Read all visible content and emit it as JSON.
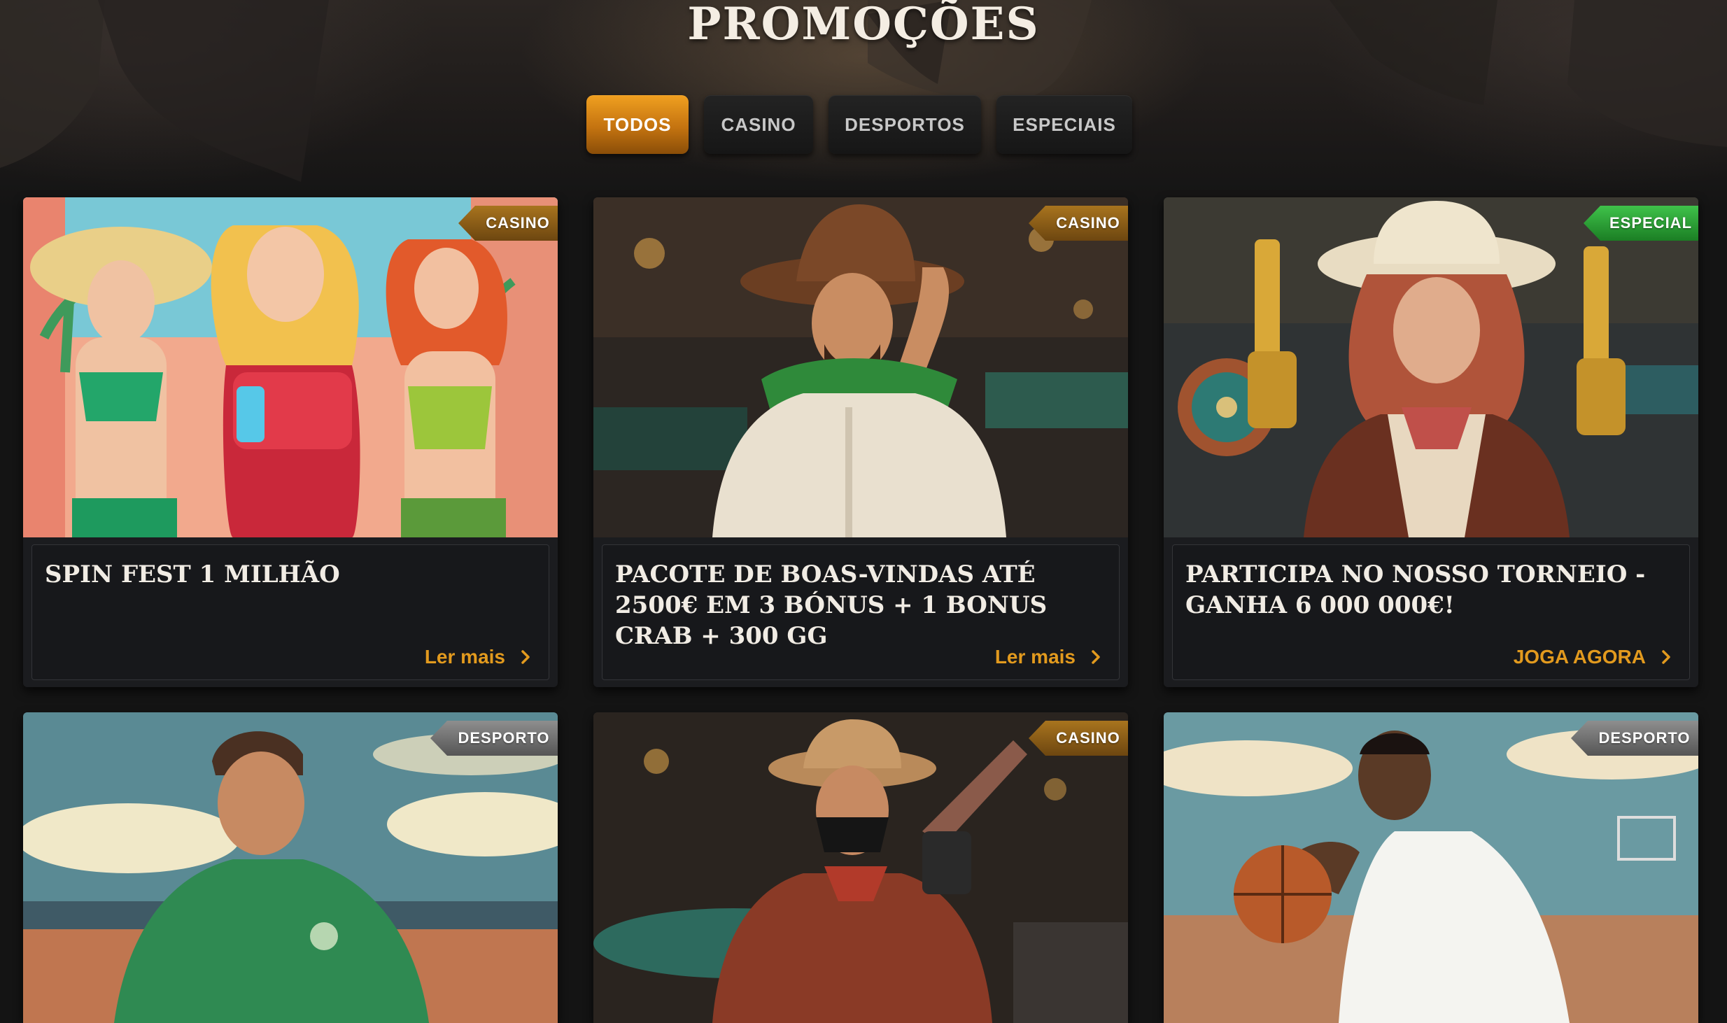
{
  "page": {
    "title": "PROMOÇÕES"
  },
  "tabs": [
    {
      "label": "TODOS",
      "active": true
    },
    {
      "label": "CASINO",
      "active": false
    },
    {
      "label": "DESPORTOS",
      "active": false
    },
    {
      "label": "ESPECIAIS",
      "active": false
    }
  ],
  "promotions": [
    {
      "badge": "CASINO",
      "title": "Spin Fest 1 Milhão",
      "link": "Ler mais",
      "image": "three women in summer outfits on a beach with palm trees"
    },
    {
      "badge": "CASINO",
      "title": "Pacote de boas-vindas até 2500€ em 3 bónus + 1 Bonus Crab + 300 GG",
      "link": "Ler mais",
      "image": "cowboy with green scarf tipping hat in saloon"
    },
    {
      "badge": "ESPECIAL",
      "title": "Participa no nosso torneio - ganha 6 000 000€!",
      "link": "JOGA AGORA",
      "image": "cowgirl holding two golden revolvers in casino"
    },
    {
      "badge": "DESPORTO",
      "title": "",
      "link": "",
      "image": "football player in green shirt in stadium"
    },
    {
      "badge": "CASINO",
      "title": "",
      "link": "",
      "image": "masked bandit with revolver in casino"
    },
    {
      "badge": "DESPORTO",
      "title": "",
      "link": "",
      "image": "basketball player dribbling on outdoor court"
    }
  ],
  "icons": {
    "link_arrow": "chevron-right-icon"
  },
  "colors": {
    "accent": "#e29a1e",
    "badge_casino": "#a8741e",
    "badge_especial": "#2fa63a",
    "badge_desporto": "#7a7a7a",
    "tab_active": "#e09418"
  }
}
